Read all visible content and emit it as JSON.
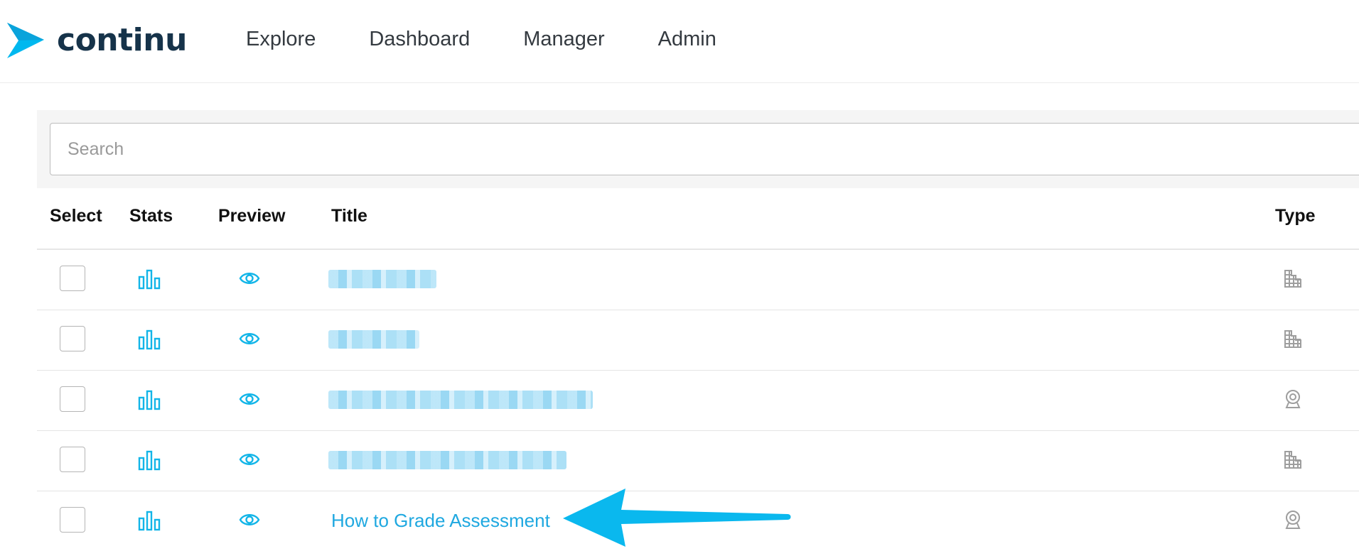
{
  "brand": {
    "name": "continu",
    "logo_icon": "continu-logo-icon",
    "accent_color": "#00b8ef",
    "text_color": "#16334a"
  },
  "nav": {
    "items": [
      {
        "label": "Explore"
      },
      {
        "label": "Dashboard"
      },
      {
        "label": "Manager"
      },
      {
        "label": "Admin"
      }
    ]
  },
  "search": {
    "placeholder": "Search",
    "value": ""
  },
  "table": {
    "headers": {
      "select": "Select",
      "stats": "Stats",
      "preview": "Preview",
      "title": "Title",
      "type": "Type"
    },
    "rows": [
      {
        "title": "",
        "title_redacted": true,
        "type_icon": "building-icon"
      },
      {
        "title": "",
        "title_redacted": true,
        "type_icon": "building-icon"
      },
      {
        "title": "",
        "title_redacted": true,
        "type_icon": "webcam-icon"
      },
      {
        "title": "",
        "title_redacted": true,
        "type_icon": "building-icon"
      },
      {
        "title": "How to Grade Assessment",
        "title_redacted": false,
        "type_icon": "webcam-icon"
      }
    ]
  },
  "annotation": {
    "icon": "callout-arrow-icon",
    "color": "#0ab8ee",
    "points_to_row": 5
  },
  "colors": {
    "link": "#1fa8e0",
    "icon_accent": "#12b5e8",
    "type_icon_gray": "#9e9e9e"
  }
}
